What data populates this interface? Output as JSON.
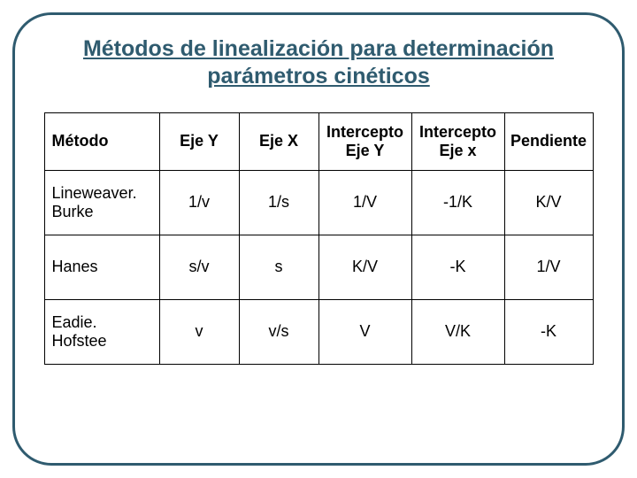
{
  "title_line1": "Métodos de linealización para determinación",
  "title_line2": "parámetros cinéticos",
  "headers": {
    "method": "Método",
    "ejeY": "Eje Y",
    "ejeX": "Eje X",
    "intY_l1": "Intercepto",
    "intY_l2": "Eje Y",
    "intX_l1": "Intercepto",
    "intX_l2": "Eje x",
    "pendiente": "Pendiente"
  },
  "rows": [
    {
      "method_l1": "Lineweaver.",
      "method_l2": "Burke",
      "ejeY": "1/v",
      "ejeX": "1/s",
      "intY": "1/V",
      "intX": "-1/K",
      "pend": "K/V"
    },
    {
      "method_l1": "Hanes",
      "method_l2": "",
      "ejeY": "s/v",
      "ejeX": "s",
      "intY": "K/V",
      "intX": "-K",
      "pend": "1/V"
    },
    {
      "method_l1": "Eadie.",
      "method_l2": "Hofstee",
      "ejeY": "v",
      "ejeX": "v/s",
      "intY": "V",
      "intX": "V/K",
      "pend": "-K"
    }
  ],
  "chart_data": {
    "type": "table",
    "title": "Métodos de linealización para determinación parámetros cinéticos",
    "columns": [
      "Método",
      "Eje Y",
      "Eje X",
      "Intercepto Eje Y",
      "Intercepto Eje x",
      "Pendiente"
    ],
    "rows": [
      [
        "Lineweaver. Burke",
        "1/v",
        "1/s",
        "1/V",
        "-1/K",
        "K/V"
      ],
      [
        "Hanes",
        "s/v",
        "s",
        "K/V",
        "-K",
        "1/V"
      ],
      [
        "Eadie. Hofstee",
        "v",
        "v/s",
        "V",
        "V/K",
        "-K"
      ]
    ]
  }
}
